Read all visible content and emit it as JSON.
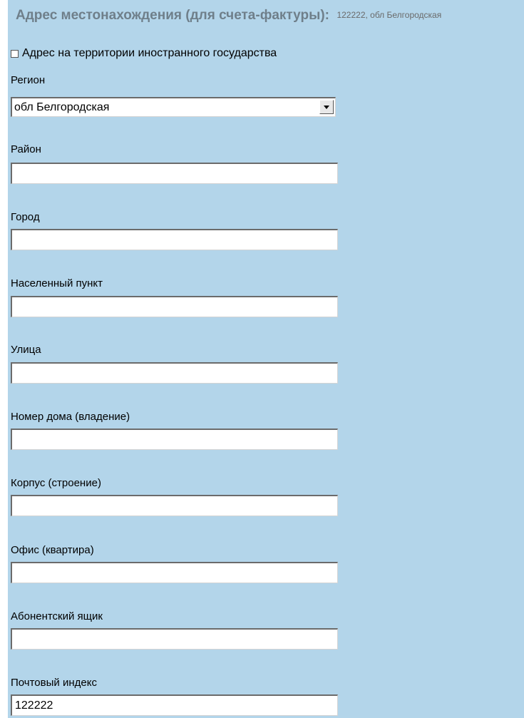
{
  "header": {
    "title": "Адрес местонахождения (для счета-фактуры):",
    "value": "122222, обл Белгородская"
  },
  "foreign_checkbox": {
    "label": "Адрес на территории иностранного государства",
    "checked": false
  },
  "region": {
    "label": "Регион",
    "value": "обл Белгородская",
    "icon": "chevron-down-icon"
  },
  "fields": {
    "district": {
      "label": "Район",
      "value": ""
    },
    "city": {
      "label": "Город",
      "value": ""
    },
    "settlement": {
      "label": "Населенный пункт",
      "value": ""
    },
    "street": {
      "label": "Улица",
      "value": ""
    },
    "house": {
      "label": "Номер дома (владение)",
      "value": ""
    },
    "building": {
      "label": "Корпус (строение)",
      "value": ""
    },
    "office": {
      "label": "Офис (квартира)",
      "value": ""
    },
    "po_box": {
      "label": "Абонентский ящик",
      "value": ""
    },
    "postal_code": {
      "label": "Почтовый индекс",
      "value": "122222"
    }
  }
}
